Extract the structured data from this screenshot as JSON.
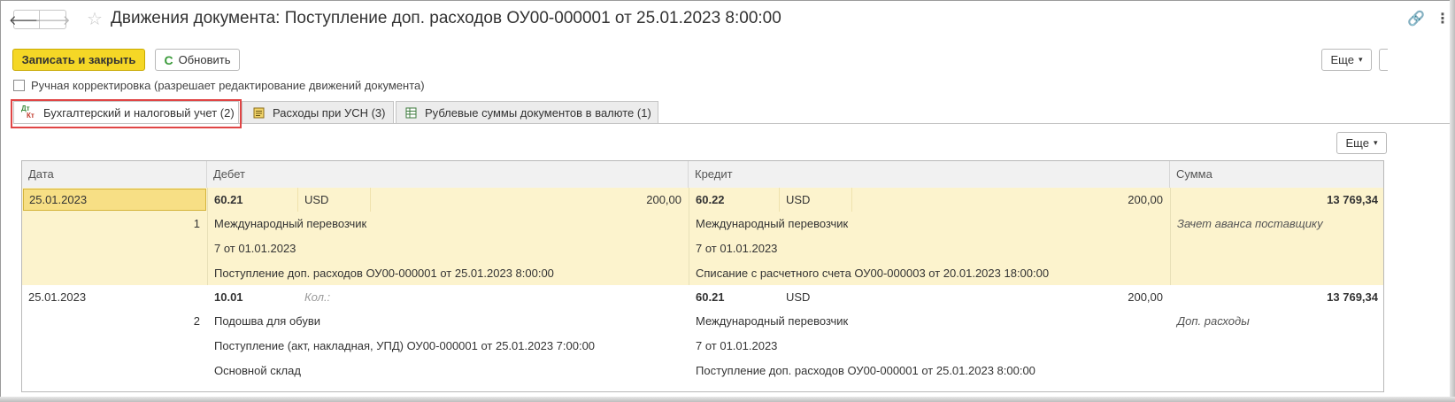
{
  "window": {
    "back_glyph": "🡐",
    "forward_glyph": "🡒",
    "star_glyph": "☆",
    "title": "Движения документа: Поступление доп. расходов ОУ00-000001 от 25.01.2023 8:00:00",
    "link_glyph": "🔗",
    "menu_glyph": "⋮"
  },
  "toolbar": {
    "save_close_label": "Записать и закрыть",
    "refresh_label": "Обновить",
    "refresh_glyph": "C",
    "more_label": "Еще",
    "caret_glyph": "▾"
  },
  "manual_edit": {
    "label": "Ручная корректировка (разрешает редактирование движений документа)",
    "checked": false
  },
  "tabs": [
    {
      "label": "Бухгалтерский и налоговый учет (2)",
      "icon_top": "Дт",
      "icon_bottom": "Кт",
      "active": true
    },
    {
      "label": "Расходы при УСН (3)",
      "icon": "register-icon",
      "active": false
    },
    {
      "label": "Рублевые суммы документов в валюте (1)",
      "icon": "table-icon",
      "active": false
    }
  ],
  "grid": {
    "more_label": "Еще",
    "columns": [
      "Дата",
      "Дебет",
      "Кредит",
      "Сумма"
    ],
    "rows": [
      {
        "date": "25.01.2023",
        "number": "1",
        "debit_account": "60.21",
        "debit_currency": "USD",
        "debit_amount": "200,00",
        "debit_lines": [
          "Международный перевозчик",
          "7 от 01.01.2023",
          "Поступление доп. расходов ОУ00-000001 от 25.01.2023 8:00:00"
        ],
        "credit_account": "60.22",
        "credit_currency": "USD",
        "credit_amount": "200,00",
        "credit_lines": [
          "Международный перевозчик",
          "7 от 01.01.2023",
          "Списание с расчетного счета ОУ00-000003 от 20.01.2023 18:00:00"
        ],
        "sum": "13 769,34",
        "content": "Зачет аванса поставщику"
      },
      {
        "date": "25.01.2023",
        "number": "2",
        "debit_account": "10.01",
        "debit_qty_label": "Кол.:",
        "debit_lines": [
          "Подошва для обуви",
          "Поступление (акт, накладная, УПД) ОУ00-000001 от 25.01.2023 7:00:00",
          "Основной склад"
        ],
        "credit_account": "60.21",
        "credit_currency": "USD",
        "credit_amount": "200,00",
        "credit_lines": [
          "Международный перевозчик",
          "7 от 01.01.2023",
          "Поступление доп. расходов ОУ00-000001 от 25.01.2023 8:00:00"
        ],
        "sum": "13 769,34",
        "content": "Доп. расходы"
      }
    ]
  },
  "colors": {
    "primary_button": "#f5d726",
    "selected_row": "#fcf3cd",
    "highlight_box": "#e04545"
  }
}
